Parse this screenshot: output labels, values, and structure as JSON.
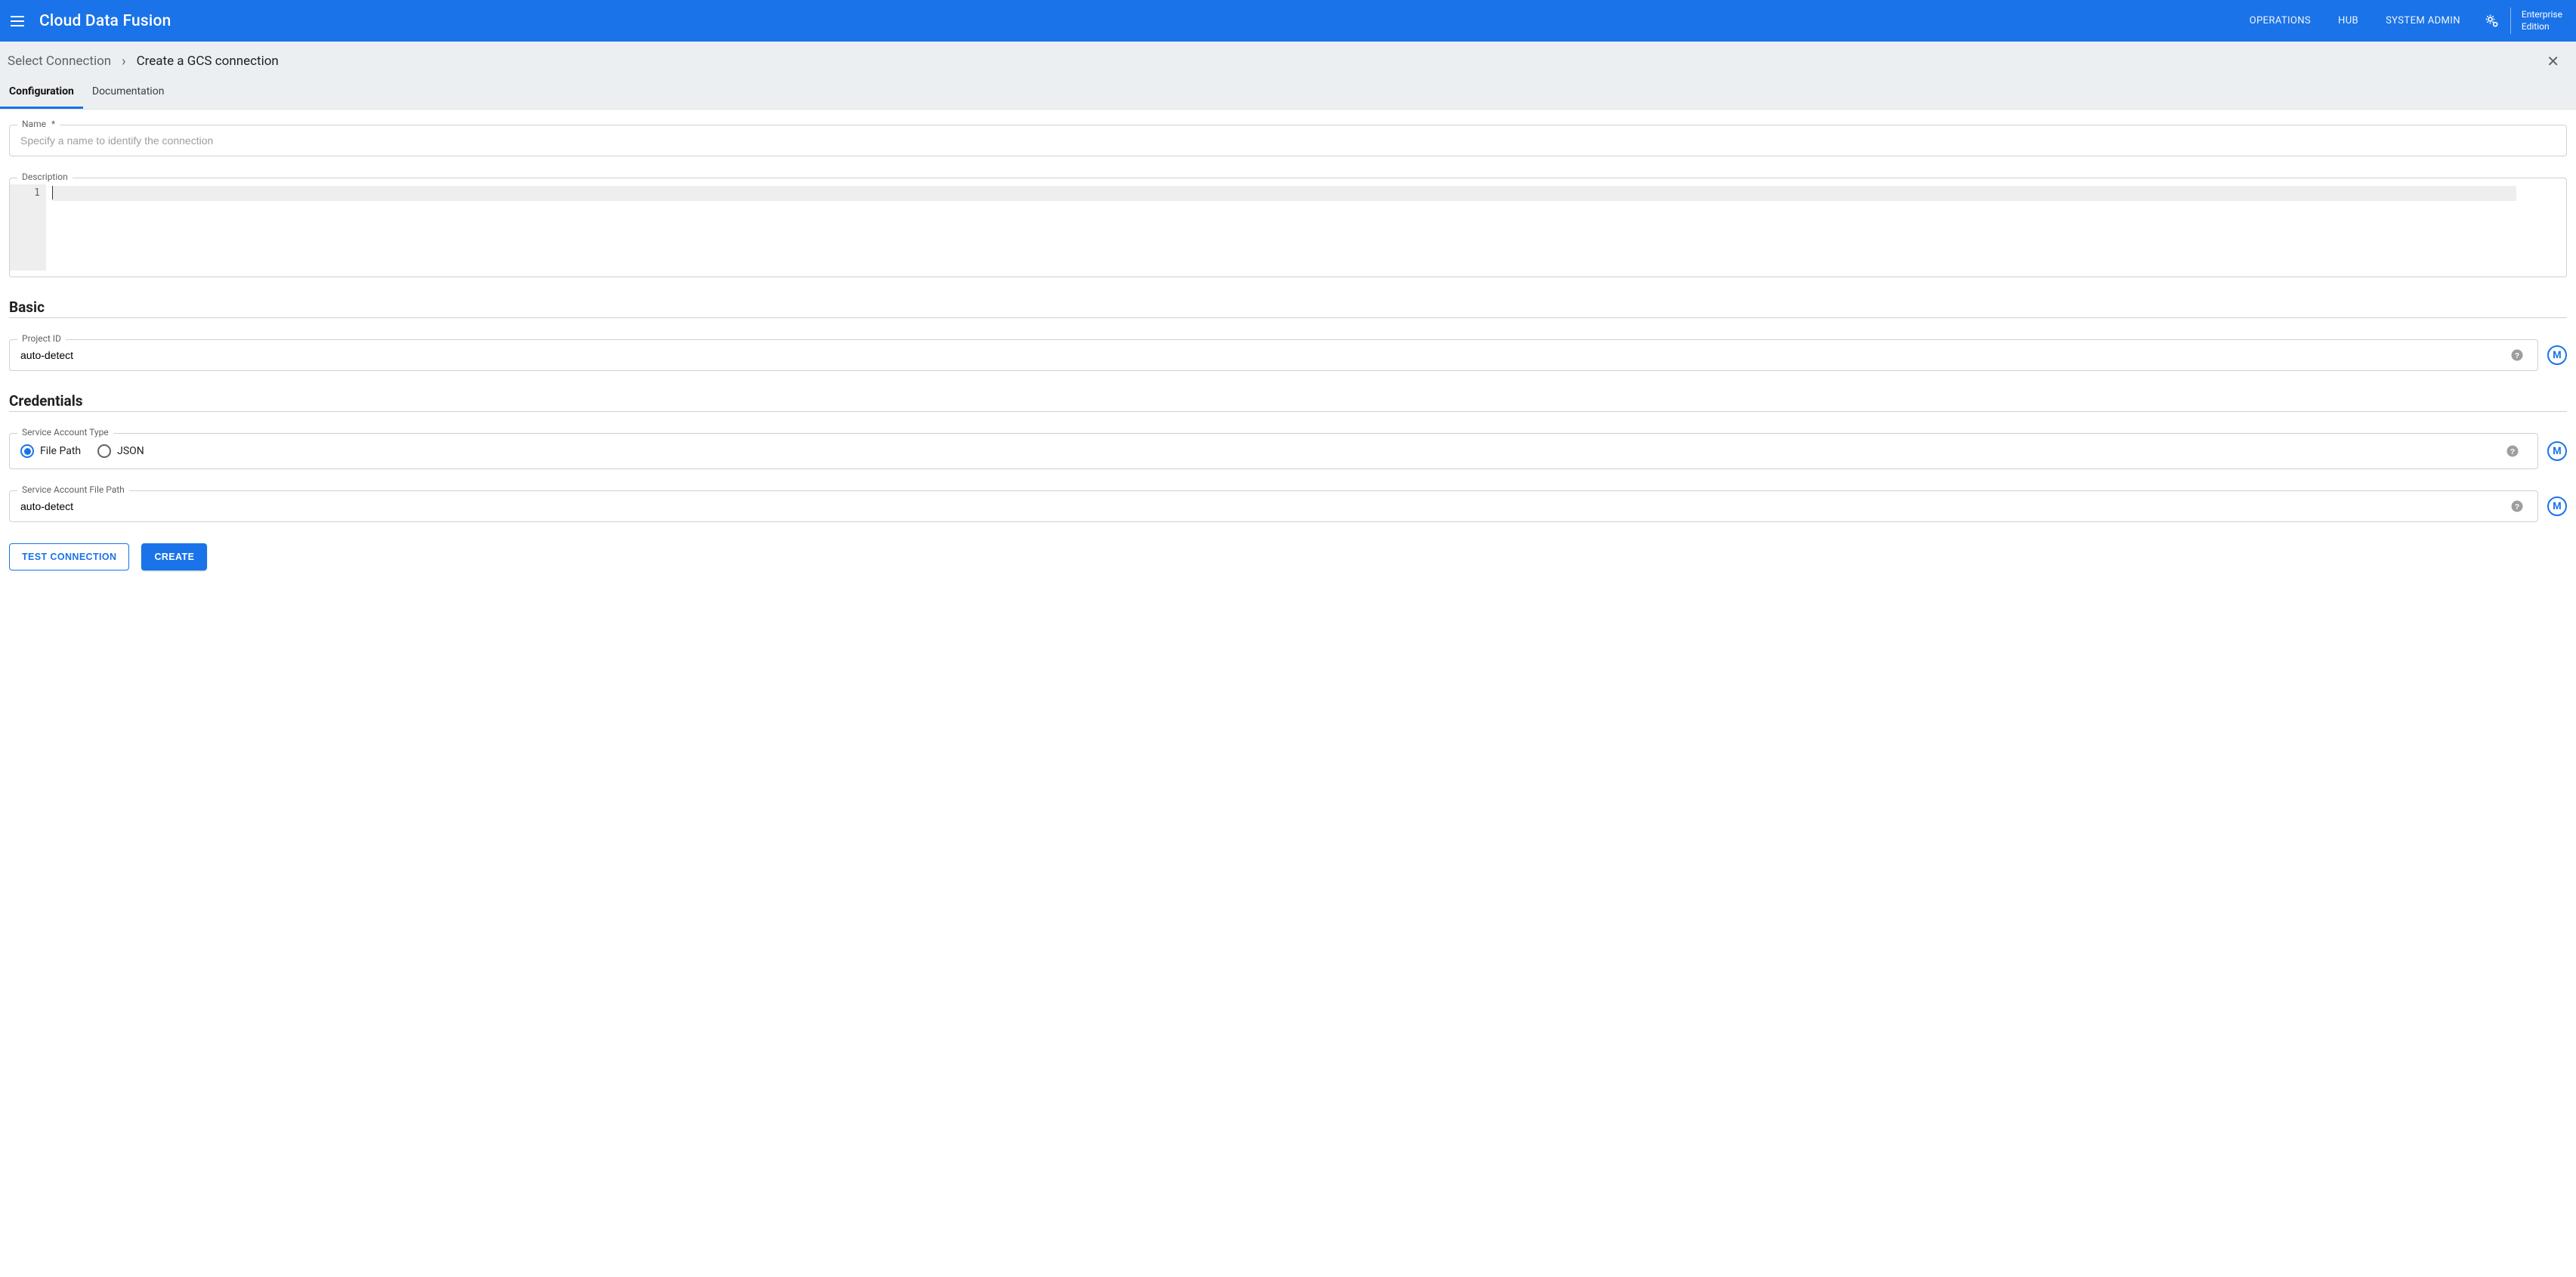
{
  "header": {
    "brand": "Cloud Data Fusion",
    "nav": {
      "operations": "OPERATIONS",
      "hub": "HUB",
      "system_admin": "SYSTEM ADMIN"
    },
    "edition_line1": "Enterprise",
    "edition_line2": "Edition"
  },
  "breadcrumb": {
    "select_connection": "Select Connection",
    "current": "Create a GCS connection"
  },
  "tabs": {
    "configuration": "Configuration",
    "documentation": "Documentation"
  },
  "fields": {
    "name": {
      "label": "Name",
      "required": "*",
      "placeholder": "Specify a name to identify the connection",
      "value": ""
    },
    "description": {
      "label": "Description",
      "line_number": "1",
      "value": ""
    },
    "basic_heading": "Basic",
    "project_id": {
      "label": "Project ID",
      "value": "auto-detect"
    },
    "credentials_heading": "Credentials",
    "service_account_type": {
      "label": "Service Account Type",
      "opt_file_path": "File Path",
      "opt_json": "JSON",
      "selected": "file_path"
    },
    "service_account_file_path": {
      "label": "Service Account File Path",
      "value": "auto-detect"
    }
  },
  "macro_label": "M",
  "buttons": {
    "test": "TEST CONNECTION",
    "create": "CREATE"
  }
}
